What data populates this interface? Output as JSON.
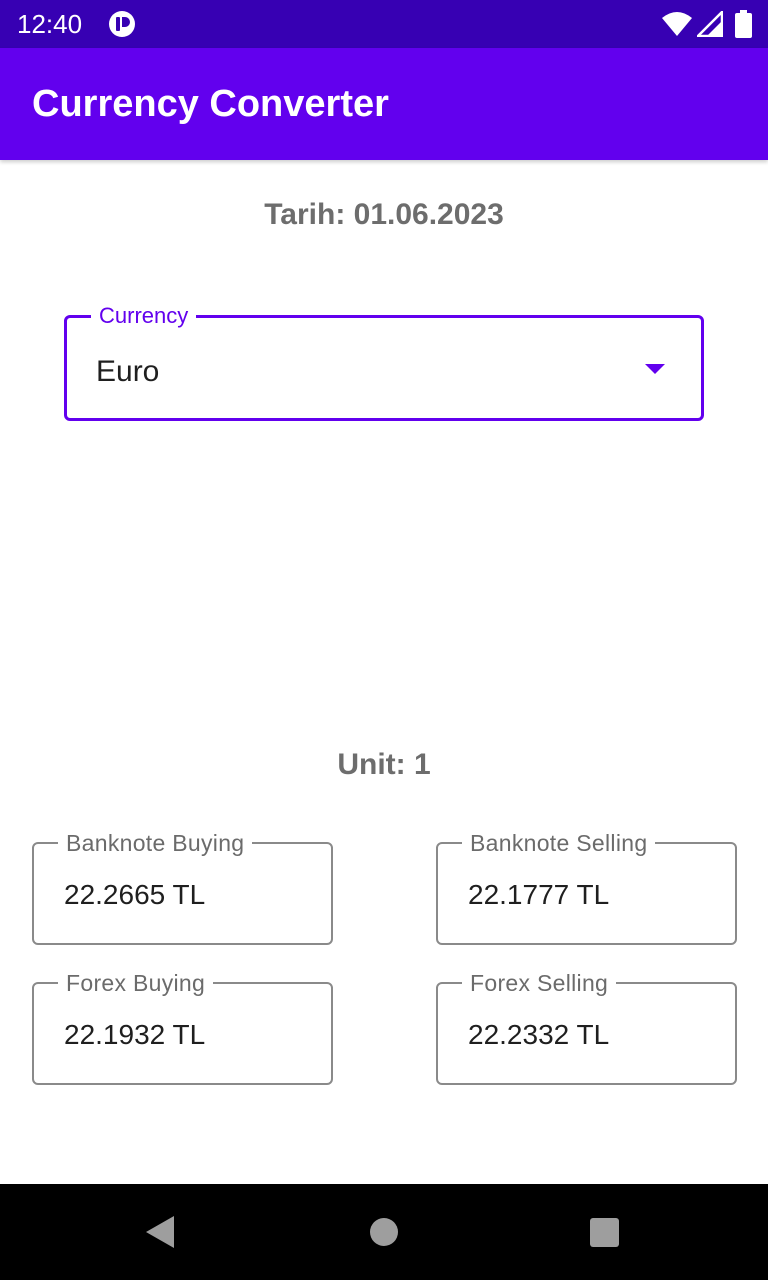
{
  "status_bar": {
    "time": "12:40",
    "icons": [
      "app-notification-icon",
      "wifi-icon",
      "cell-signal-icon",
      "battery-icon"
    ]
  },
  "app_bar": {
    "title": "Currency Converter"
  },
  "date": {
    "text": "Tarih: 01.06.2023"
  },
  "currency": {
    "label": "Currency",
    "value": "Euro"
  },
  "unit": {
    "text": "Unit: 1"
  },
  "rates": [
    {
      "label": "Banknote Buying",
      "value": "22.2665 TL"
    },
    {
      "label": "Banknote Selling",
      "value": "22.1777 TL"
    },
    {
      "label": "Forex Buying",
      "value": "22.1932 TL"
    },
    {
      "label": "Forex Selling",
      "value": "22.2332 TL"
    }
  ],
  "colors": {
    "status_bar": "#3700b3",
    "app_bar": "#6200ee",
    "accent": "#6200ee",
    "secondary_text": "#6d6d6d",
    "nav_bar": "#000000"
  },
  "nav_bar": {
    "buttons": [
      "back-icon",
      "home-icon",
      "recents-icon"
    ]
  }
}
